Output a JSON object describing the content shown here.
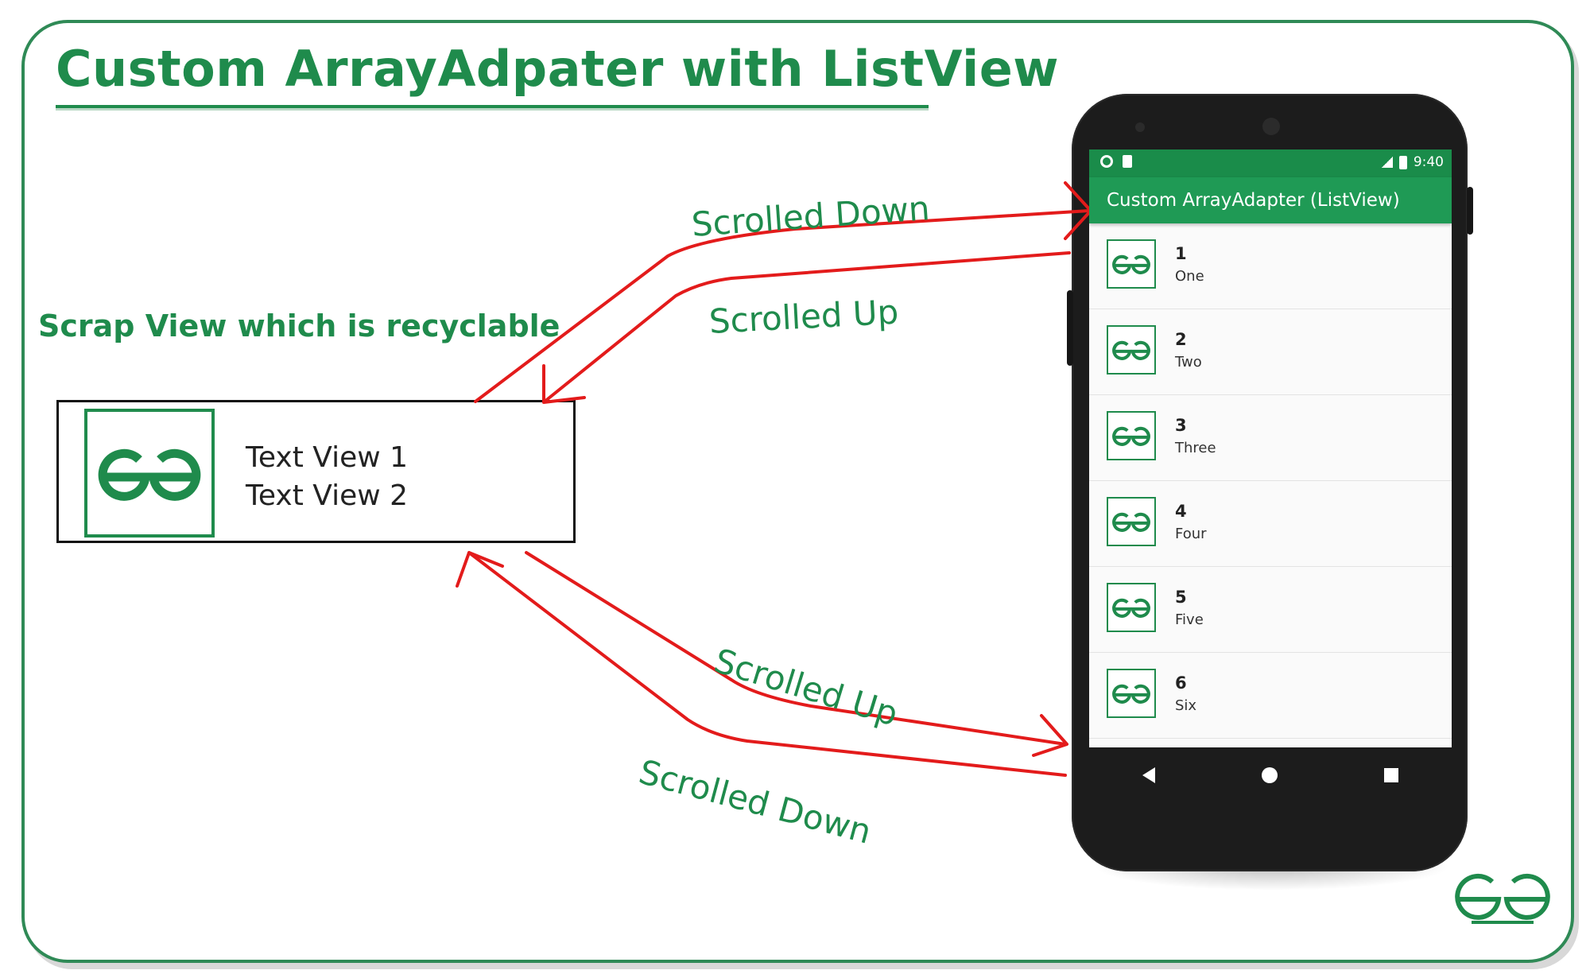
{
  "title": "Custom ArrayAdpater with ListView",
  "scrap_heading": "Scrap View which is recyclable",
  "scrap_view": {
    "text_view_1": "Text View 1",
    "text_view_2": "Text View 2"
  },
  "arrows": {
    "top_forward": "Scrolled Down",
    "top_back": "Scrolled Up",
    "bottom_forward": "Scrolled Up",
    "bottom_back": "Scrolled Down"
  },
  "phone": {
    "time": "9:40",
    "app_title": "Custom ArrayAdapter (ListView)",
    "items": [
      {
        "number": "1",
        "word": "One"
      },
      {
        "number": "2",
        "word": "Two"
      },
      {
        "number": "3",
        "word": "Three"
      },
      {
        "number": "4",
        "word": "Four"
      },
      {
        "number": "5",
        "word": "Five"
      },
      {
        "number": "6",
        "word": "Six"
      }
    ]
  },
  "colors": {
    "brand_green": "#1f8b4c",
    "arrow_red": "#e31b1b",
    "appbar_green": "#1f9a55"
  },
  "icons": [
    "gfg-logo-icon",
    "back-icon",
    "home-icon",
    "recents-icon"
  ]
}
